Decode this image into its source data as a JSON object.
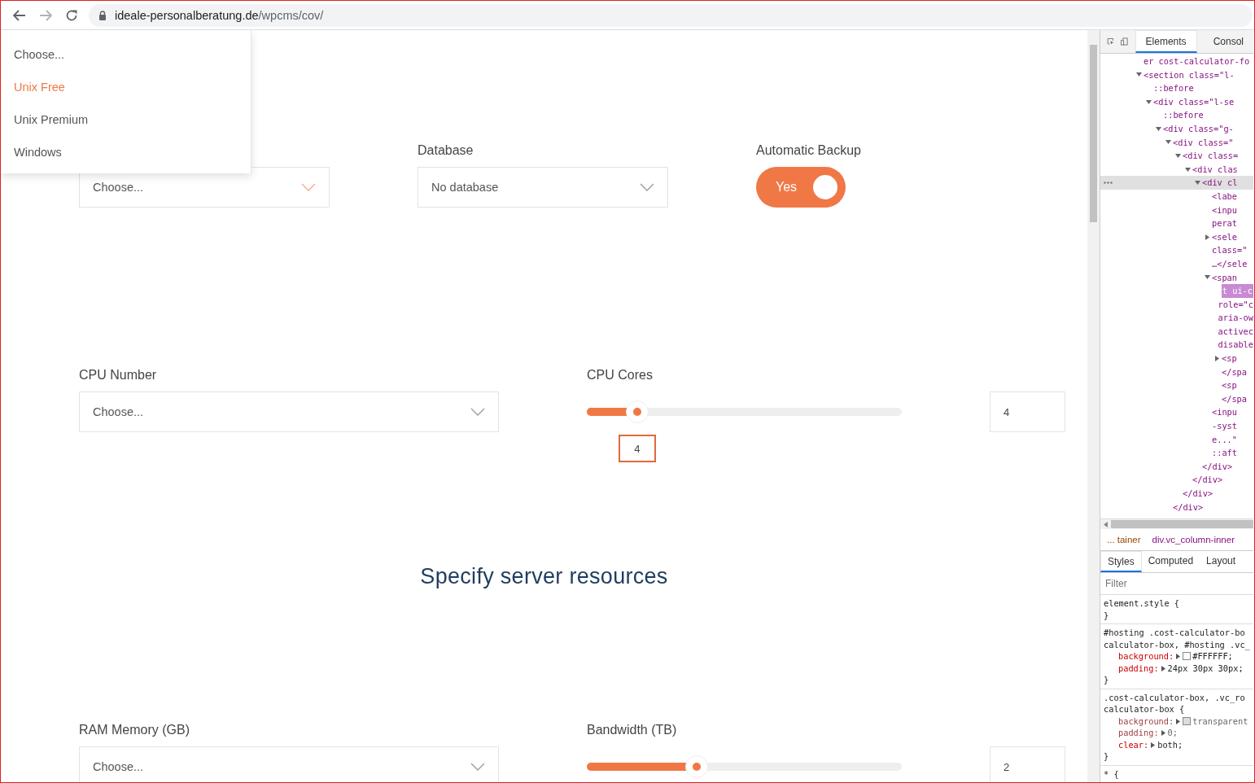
{
  "browser": {
    "url_host": "ideale-personalberatung.de",
    "url_path": "/wpcms/cov/"
  },
  "dropdown": {
    "open": true,
    "options": [
      {
        "label": "Choose...",
        "selected": false
      },
      {
        "label": "Unix Free",
        "selected": true
      },
      {
        "label": "Unix Premium",
        "selected": false
      },
      {
        "label": "Windows",
        "selected": false
      }
    ]
  },
  "row1": {
    "os_select": {
      "value": "Choose...",
      "open": true
    },
    "database": {
      "label": "Database",
      "value": "No database",
      "open": false
    },
    "backup": {
      "label": "Automatic Backup",
      "on": true,
      "text": "Yes"
    }
  },
  "row2": {
    "cpu_number": {
      "label": "CPU Number",
      "value": "Choose...",
      "open": false
    },
    "cpu_cores": {
      "label": "CPU Cores",
      "level": 0.16,
      "tooltip": "4",
      "input": "4"
    }
  },
  "heading": "Specify server resources",
  "row3": {
    "ram": {
      "label": "RAM Memory (GB)",
      "value": "Choose...",
      "open": false
    },
    "bandwidth": {
      "label": "Bandwidth (TB)",
      "level": 0.35,
      "input": "2"
    }
  },
  "devtools": {
    "tabs": [
      {
        "label": "Elements",
        "selected": true
      },
      {
        "label": "Consol",
        "selected": false
      }
    ],
    "tree": [
      {
        "text": "er cost-calculator-fo",
        "kind": "plain"
      },
      {
        "text": "<section class=\"l-",
        "kind": "open",
        "children": [
          {
            "text": "::before",
            "kind": "plain"
          },
          {
            "text": "<div class=\"l-se",
            "kind": "open",
            "children": [
              {
                "text": "::before",
                "kind": "plain"
              },
              {
                "text": "<div class=\"g-",
                "kind": "open",
                "children": [
                  {
                    "text": "<div class=\"",
                    "kind": "open",
                    "children": [
                      {
                        "text": "<div class=",
                        "kind": "open",
                        "children": [
                          {
                            "text": "<div clas",
                            "kind": "open",
                            "children": [
                              {
                                "text": "<div cl",
                                "kind": "current",
                                "children": [
                                  {
                                    "text": "<labe",
                                    "kind": "plain"
                                  },
                                  {
                                    "text": "<inpu",
                                    "kind": "plain"
                                  },
                                  {
                                    "text": "perat",
                                    "kind": "plain"
                                  },
                                  {
                                    "text": "<sele",
                                    "kind": "closed"
                                  },
                                  {
                                    "text": "class=\"",
                                    "kind": "plain"
                                  },
                                  {
                                    "text": "…</sele",
                                    "kind": "plain"
                                  },
                                  {
                                    "text": "<span",
                                    "kind": "open",
                                    "children": [
                                      {
                                        "text": "t ui-c",
                                        "kind": "match"
                                      },
                                      {
                                        "text": "role=\"c",
                                        "kind": "plain"
                                      },
                                      {
                                        "text": "aria-ow",
                                        "kind": "plain"
                                      },
                                      {
                                        "text": "activec",
                                        "kind": "plain"
                                      },
                                      {
                                        "text": "disable",
                                        "kind": "plain"
                                      },
                                      {
                                        "text": "<sp",
                                        "kind": "closed"
                                      },
                                      {
                                        "text": "</spa",
                                        "kind": "plain"
                                      },
                                      {
                                        "text": "<sp",
                                        "kind": "plain"
                                      },
                                      {
                                        "text": "</spa",
                                        "kind": "plain"
                                      }
                                    ]
                                  },
                                  {
                                    "text": "<inpu",
                                    "kind": "plain"
                                  },
                                  {
                                    "text": "-syst",
                                    "kind": "plain"
                                  },
                                  {
                                    "text": "e...\"",
                                    "kind": "plain"
                                  },
                                  {
                                    "text": "::aft",
                                    "kind": "plain"
                                  }
                                ]
                              },
                              {
                                "text": "</div>",
                                "kind": "plain"
                              }
                            ]
                          },
                          {
                            "text": "</div>",
                            "kind": "plain"
                          }
                        ]
                      },
                      {
                        "text": "</div>",
                        "kind": "plain"
                      }
                    ]
                  },
                  {
                    "text": "</div>",
                    "kind": "plain"
                  }
                ]
              }
            ]
          }
        ]
      }
    ],
    "breadcrumbs": [
      "... tainer",
      "div.vc_column-inner"
    ],
    "style_tabs": [
      {
        "label": "Styles",
        "selected": true
      },
      {
        "label": "Computed",
        "selected": false
      },
      {
        "label": "Layout",
        "selected": false
      }
    ],
    "filter_placeholder": "Filter",
    "rules": [
      [
        {
          "kind": "selector",
          "text": "element.style {"
        },
        {
          "kind": "brace",
          "text": "}"
        }
      ],
      [
        {
          "kind": "selector",
          "text": "#hosting .cost-calculator-bo"
        },
        {
          "kind": "selector",
          "text": "calculator-box, #hosting .vc_"
        },
        {
          "kind": "swatch",
          "name": "background:",
          "value": "#FFFFFF;"
        },
        {
          "kind": "prop",
          "name": "padding:",
          "value": "24px 30px 30px;"
        },
        {
          "kind": "brace",
          "text": "}"
        }
      ],
      [
        {
          "kind": "selector",
          "text": ".cost-calculator-box, .vc_ro"
        },
        {
          "kind": "selector",
          "text": "calculator-box {"
        },
        {
          "kind": "struck-swatch",
          "name": "background:",
          "value": "transparent"
        },
        {
          "kind": "struck",
          "name": "padding:",
          "value": "0;"
        },
        {
          "kind": "prop",
          "name": "clear:",
          "value": "both;"
        },
        {
          "kind": "brace",
          "text": "}"
        }
      ],
      [
        {
          "kind": "selector",
          "text": "* {"
        }
      ]
    ]
  }
}
